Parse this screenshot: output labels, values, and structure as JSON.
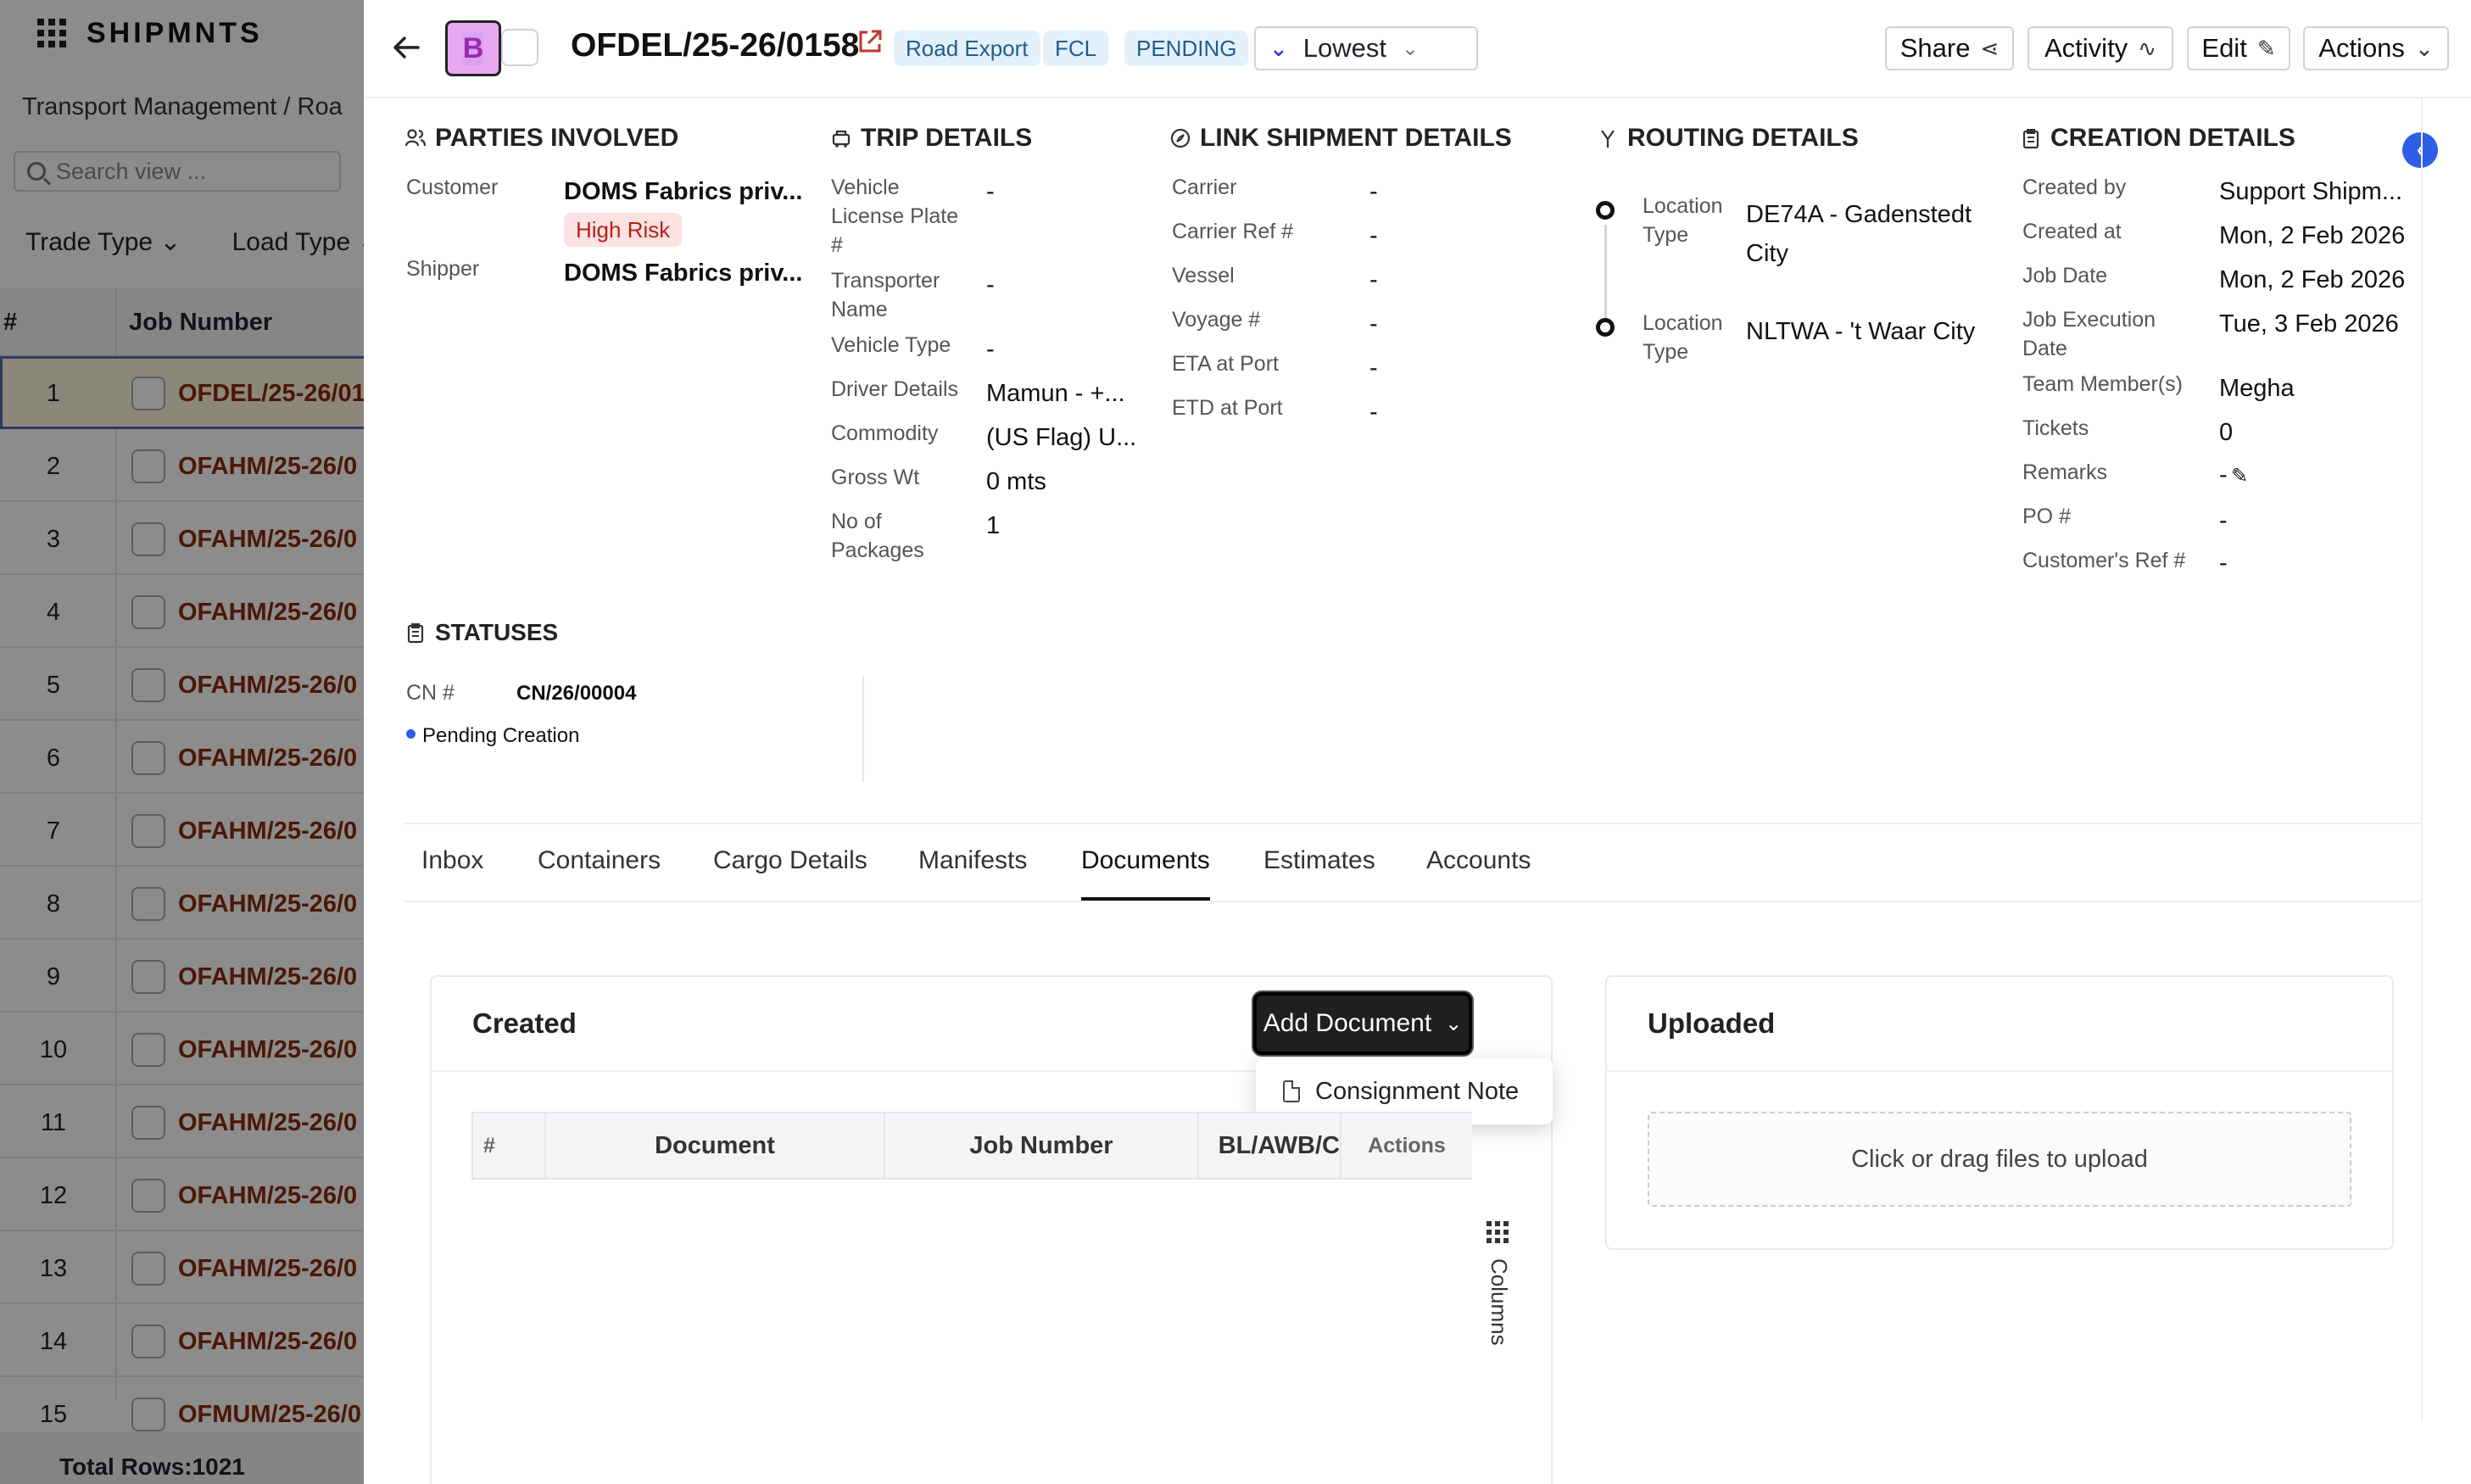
{
  "app": {
    "brand": "SHIPMNTS",
    "breadcrumb": "Transport Management  /  Roa",
    "search_placeholder": "Search view ...",
    "filters": [
      "Trade Type",
      "Load Type"
    ],
    "table_headers": {
      "index": "#",
      "job": "Job Number"
    },
    "rows": [
      {
        "n": "1",
        "job": "OFDEL/25-26/01"
      },
      {
        "n": "2",
        "job": "OFAHM/25-26/0"
      },
      {
        "n": "3",
        "job": "OFAHM/25-26/0"
      },
      {
        "n": "4",
        "job": "OFAHM/25-26/0"
      },
      {
        "n": "5",
        "job": "OFAHM/25-26/0"
      },
      {
        "n": "6",
        "job": "OFAHM/25-26/0"
      },
      {
        "n": "7",
        "job": "OFAHM/25-26/0"
      },
      {
        "n": "8",
        "job": "OFAHM/25-26/0"
      },
      {
        "n": "9",
        "job": "OFAHM/25-26/0"
      },
      {
        "n": "10",
        "job": "OFAHM/25-26/0"
      },
      {
        "n": "11",
        "job": "OFAHM/25-26/0"
      },
      {
        "n": "12",
        "job": "OFAHM/25-26/0"
      },
      {
        "n": "13",
        "job": "OFAHM/25-26/0"
      },
      {
        "n": "14",
        "job": "OFAHM/25-26/0"
      },
      {
        "n": "15",
        "job": "OFMUM/25-26/0"
      }
    ],
    "total_rows": "Total Rows:1021"
  },
  "header": {
    "avatar_letter": "B",
    "job_id": "OFDEL/25-26/0158",
    "tags": [
      "Road Export",
      "FCL",
      "PENDING"
    ],
    "priority": "Lowest",
    "buttons": {
      "share": "Share",
      "activity": "Activity",
      "edit": "Edit",
      "actions": "Actions"
    }
  },
  "parties": {
    "title": "PARTIES INVOLVED",
    "customer_label": "Customer",
    "customer_value": "DOMS Fabrics priv...",
    "risk": "High Risk",
    "shipper_label": "Shipper",
    "shipper_value": "DOMS Fabrics priv..."
  },
  "trip": {
    "title": "TRIP DETAILS",
    "fields": [
      {
        "label": "Vehicle License Plate #",
        "value": "-"
      },
      {
        "label": "Transporter Name",
        "value": "-"
      },
      {
        "label": "Vehicle Type",
        "value": "-"
      },
      {
        "label": "Driver Details",
        "value": "Mamun - +..."
      },
      {
        "label": "Commodity",
        "value": "(US Flag) U..."
      },
      {
        "label": "Gross Wt",
        "value": "0 mts"
      },
      {
        "label": "No of Packages",
        "value": "1"
      }
    ]
  },
  "link": {
    "title": "LINK SHIPMENT DETAILS",
    "fields": [
      {
        "label": "Carrier",
        "value": "-"
      },
      {
        "label": "Carrier Ref #",
        "value": "-"
      },
      {
        "label": "Vessel",
        "value": "-"
      },
      {
        "label": "Voyage #",
        "value": "-"
      },
      {
        "label": "ETA at Port",
        "value": "-"
      },
      {
        "label": "ETD at Port",
        "value": "-"
      }
    ]
  },
  "routing": {
    "title": "ROUTING DETAILS",
    "stops": [
      {
        "label": "Location Type",
        "value": "DE74A - Gadenstedt City"
      },
      {
        "label": "Location Type",
        "value": "NLTWA - 't Waar City"
      }
    ]
  },
  "creation": {
    "title": "CREATION DETAILS",
    "fields": [
      {
        "label": "Created by",
        "value": "Support Shipm..."
      },
      {
        "label": "Created at",
        "value": "Mon, 2 Feb 2026"
      },
      {
        "label": "Job Date",
        "value": "Mon, 2 Feb 2026"
      },
      {
        "label": "Job Execution Date",
        "value": "Tue, 3 Feb 2026"
      },
      {
        "label": "Team Member(s)",
        "value": "Megha"
      },
      {
        "label": "Tickets",
        "value": "0"
      },
      {
        "label": "Remarks",
        "value": "-"
      },
      {
        "label": "PO #",
        "value": "-"
      },
      {
        "label": "Customer's Ref #",
        "value": "-"
      }
    ]
  },
  "statuses": {
    "title": "STATUSES",
    "cn_label": "CN #",
    "cn_value": "CN/26/00004",
    "state": "Pending Creation"
  },
  "tabs": [
    "Inbox",
    "Containers",
    "Cargo Details",
    "Manifests",
    "Documents",
    "Estimates",
    "Accounts"
  ],
  "active_tab": "Documents",
  "documents": {
    "created_title": "Created",
    "add_button": "Add Document",
    "menu_item": "Consignment Note",
    "columns": [
      "#",
      "Document",
      "Job Number",
      "BL/AWB/C",
      "Actions"
    ],
    "columns_panel": "Columns",
    "uploaded_title": "Uploaded",
    "upload_hint": "Click or drag files to upload"
  },
  "colors": {
    "accent": "#2f5ee8",
    "risk_bg": "#fde2e2",
    "risk_text": "#b42318",
    "tag_bg": "#e4f1fb"
  }
}
